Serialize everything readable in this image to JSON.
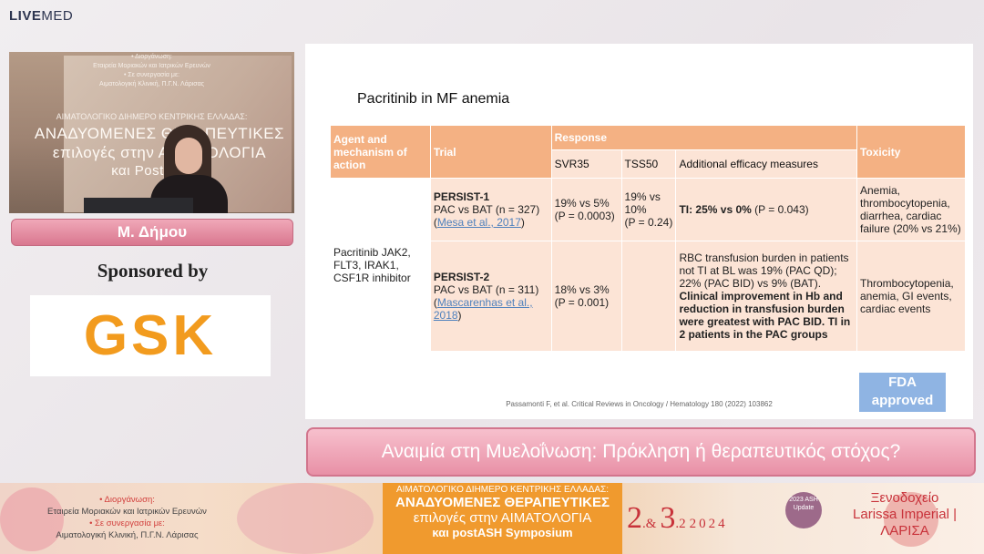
{
  "logo": {
    "live": "LIVE",
    "med": "MED"
  },
  "camera": {
    "line1": "• Διοργάνωση:",
    "line2": "Εταιρεία Μοριακών και Ιατρικών Ερευνών",
    "line3": "• Σε συνεργασία με:",
    "line4": "Αιματολογική Κλινική, Π.Γ.Ν. Λάρισας",
    "banner_l1": "ΑΙΜΑΤΟΛΟΓΙΚΟ ΔΙΗΜΕΡΟ ΚΕΝΤΡΙΚΗΣ ΕΛΛΑΔΑΣ:",
    "banner_l2": "ΑΝΑΔΥΟΜΕΝΕΣ ΘΕΡΑΠΕΥΤΙΚΕΣ",
    "banner_l3": "επιλογές στην ΑΙΜΑΤΟΛΟΓΙΑ",
    "banner_l4": "και Post-Ash S"
  },
  "speaker_name": "Μ. Δήμου",
  "sponsored_label": "Sponsored by",
  "sponsor_logo": "GSK",
  "slide": {
    "title": "Pacritinib  in MF anemia",
    "headers": {
      "agent": "Agent and mechanism of action",
      "trial": "Trial",
      "response": "Response",
      "toxicity": "Toxicity",
      "svr35": "SVR35",
      "tss50": "TSS50",
      "additional": "Additional efficacy measures"
    },
    "agent_text": "Pacritinib JAK2, FLT3, IRAK1, CSF1R inhibitor",
    "rows": [
      {
        "trial_name": "PERSIST-1",
        "trial_desc": "PAC vs BAT (n = 327)",
        "ref_open": "(",
        "ref": "Mesa et al., 2017",
        "ref_close": ")",
        "svr35": "19% vs 5%",
        "svr35_p": "(P = 0.0003)",
        "tss50": "19% vs 10%",
        "tss50_p": "(P = 0.24)",
        "additional_bold": "TI: 25% vs 0%",
        "additional_rest": " (P = 0.043)",
        "toxicity": "Anemia, thrombocytopenia, diarrhea, cardiac failure (20% vs 21%)"
      },
      {
        "trial_name": "PERSIST-2",
        "trial_desc": "PAC vs BAT (n = 311)",
        "ref_open": "(",
        "ref": "Mascarenhas et al., 2018",
        "ref_close": ")",
        "svr35": "18% vs 3%",
        "svr35_p": "(P = 0.001)",
        "tss50": "",
        "tss50_p": "",
        "additional_plain": "RBC transfusion burden in patients not TI at BL was 19% (PAC QD); 22% (PAC BID) vs 9% (BAT).",
        "additional_bold": "Clinical improvement in Hb and reduction in transfusion burden were greatest with PAC BID. TI in 2 patients in the PAC groups",
        "toxicity": "Thrombocytopenia, anemia, GI events, cardiac events"
      }
    ],
    "citation": "Passamonti F, et al. Critical Reviews in Oncology / Hematology 180 (2022) 103862",
    "fda_badge": "FDA approved"
  },
  "lower_third": "Αναιμία στη Μυελοΐνωση: Πρόκληση ή θεραπευτικός στόχος?",
  "banner": {
    "org_l1": "• Διοργάνωση:",
    "org_l2": "Εταιρεία Μοριακών και Ιατρικών Ερευνών",
    "org_l3": "• Σε συνεργασία με:",
    "org_l4": "Αιματολογική Κλινική, Π.Γ.Ν. Λάρισας",
    "center_l1": "ΑΙΜΑΤΟΛΟΓΙΚΟ ΔΙΗΜΕΡΟ ΚΕΝΤΡΙΚΗΣ ΕΛΛΑΔΑΣ:",
    "center_l2": "ΑΝΑΔΥΟΜΕΝΕΣ ΘΕΡΑΠΕΥΤΙΚΕΣ",
    "center_l3": "επιλογές στην ΑΙΜΑΤΟΛΟΓΙΑ",
    "center_l4": "και postASH Symposium",
    "day1": "2",
    "day_sep": ".&",
    "day2": "3",
    "month": ".2",
    "year": "2024",
    "ash_badge": "2023 ASH Update",
    "venue_l1": "Ξενοδοχείο",
    "venue_l2": "Larissa Imperial | ΛΑΡΙΣΑ"
  },
  "colors": {
    "table_header": "#f4b183",
    "table_cell": "#fce4d6",
    "fda_badge": "#8fb4e3",
    "lower_third": "#e890a6",
    "banner_orange": "#f09a2e",
    "accent_red": "#c8323a",
    "gsk_orange": "#f29b1e"
  }
}
